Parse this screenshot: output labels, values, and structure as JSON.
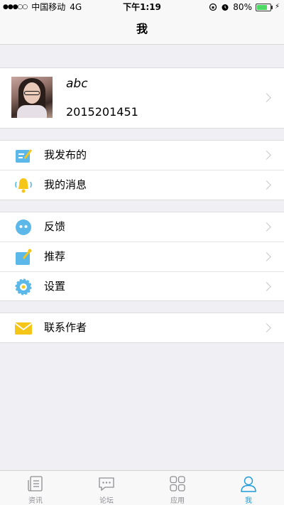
{
  "status_bar": {
    "carrier": "中国移动",
    "network": "4G",
    "time": "下午1:19",
    "battery": "80%",
    "battery_level": 0.8
  },
  "nav": {
    "title": "我"
  },
  "profile": {
    "name": "abc",
    "id": "2015201451"
  },
  "menu": {
    "group1": [
      {
        "label": "我发布的",
        "icon": "edit-icon"
      },
      {
        "label": "我的消息",
        "icon": "bell-icon"
      }
    ],
    "group2": [
      {
        "label": "反馈",
        "icon": "feedback-icon"
      },
      {
        "label": "推荐",
        "icon": "recommend-icon"
      },
      {
        "label": "设置",
        "icon": "gear-icon"
      }
    ],
    "group3": [
      {
        "label": "联系作者",
        "icon": "mail-icon"
      }
    ]
  },
  "tabs": [
    {
      "label": "资讯",
      "icon": "news-icon"
    },
    {
      "label": "论坛",
      "icon": "forum-icon"
    },
    {
      "label": "应用",
      "icon": "apps-icon"
    },
    {
      "label": "我",
      "icon": "user-icon",
      "active": true
    }
  ],
  "colors": {
    "accent": "#1e9bd8",
    "icon_blue": "#5bb8e8",
    "icon_yellow": "#f5c518",
    "background": "#efeff4"
  }
}
